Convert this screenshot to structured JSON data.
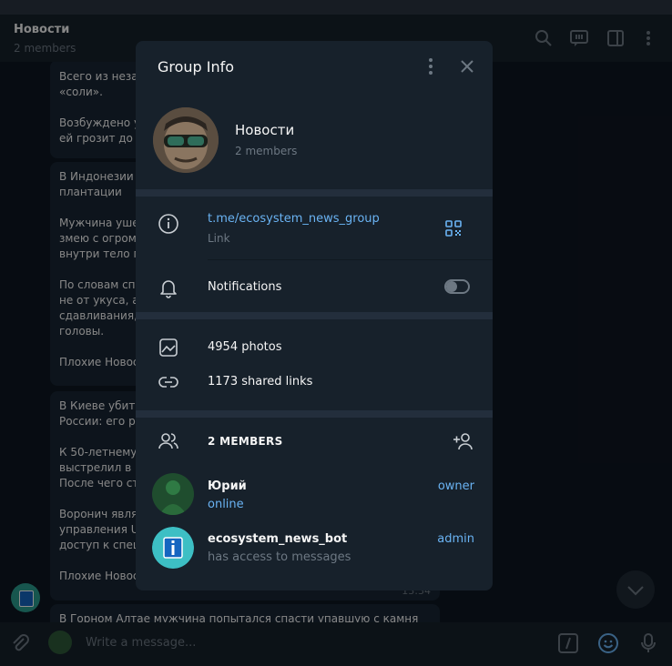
{
  "chat": {
    "title": "Новости",
    "subtitle": "2 members",
    "input_placeholder": "Write a message...",
    "messages": [
      {
        "lines": "Всего из неза\n«соли».\n\nВозбуждено у\nей грозит до 2"
      },
      {
        "lines": "В Индонезии\nплантации\n\nМужчина уше\nзмею с огром\nвнутри тело п\n\nПо словам спе\nне от укуса, а\nсдавливания,\nголовы.\n\nПлохие Новос"
      },
      {
        "lines": "В Киеве убит\nРоссии: его р\n\nК 50-летнему\nвыстрелил в н\nПосле чего ст\n\nВоронич явля\nуправления U\nдоступ к спец\n\nПлохие Новос",
        "time": "13:34"
      },
      {
        "lines": "В Горном Алтае мужчина попытался спасти упавшую с камня"
      }
    ]
  },
  "group_info": {
    "title": "Group Info",
    "name": "Новости",
    "members_count": "2 members",
    "link": "t.me/ecosystem_news_group",
    "link_label": "Link",
    "notifications_label": "Notifications",
    "notifications_enabled": false,
    "photos": "4954 photos",
    "shared_links": "1173 shared links",
    "members_header": "2 MEMBERS",
    "members": [
      {
        "name": "Юрий",
        "status": "online",
        "status_color": "#6ab3f3",
        "role": "owner"
      },
      {
        "name": "ecosystem_news_bot",
        "status": "has access to messages",
        "status_color": "#6d7883",
        "role": "admin"
      }
    ]
  },
  "colors": {
    "accent": "#6ab3f3",
    "background": "#17212b",
    "muted": "#6d7883"
  },
  "icons": [
    "search-icon",
    "topic-icon",
    "sidebar-icon",
    "more-icon",
    "close-icon",
    "info-icon",
    "qr-icon",
    "bell-icon",
    "photo-icon",
    "link-icon",
    "members-icon",
    "add-member-icon",
    "attach-icon",
    "commands-icon",
    "emoji-icon",
    "mic-icon",
    "chevron-down-icon"
  ]
}
